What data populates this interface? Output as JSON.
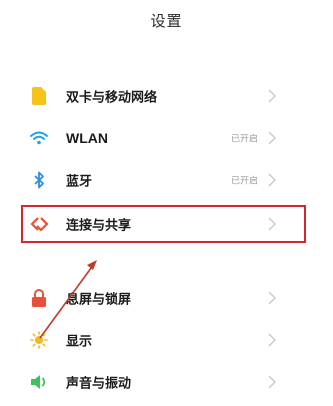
{
  "header": {
    "title": "设置"
  },
  "items": [
    {
      "label": "双卡与移动网络",
      "status": "",
      "icon": "sim-card-icon",
      "color": "#f5c31c"
    },
    {
      "label": "WLAN",
      "status": "已开启",
      "icon": "wifi-icon",
      "color": "#1aa3e8"
    },
    {
      "label": "蓝牙",
      "status": "已开启",
      "icon": "bluetooth-icon",
      "color": "#2f8de4"
    },
    {
      "label": "连接与共享",
      "status": "",
      "icon": "connection-share-icon",
      "color": "#e8503a"
    },
    {
      "label": "息屏与锁屏",
      "status": "",
      "icon": "lock-icon",
      "color": "#e8503a"
    },
    {
      "label": "显示",
      "status": "",
      "icon": "sun-icon",
      "color": "#f5b81c"
    },
    {
      "label": "声音与振动",
      "status": "",
      "icon": "speaker-icon",
      "color": "#3cc25b"
    }
  ],
  "annotation": {
    "highlight_color": "#d9242c",
    "arrow_color": "#c0392b"
  }
}
